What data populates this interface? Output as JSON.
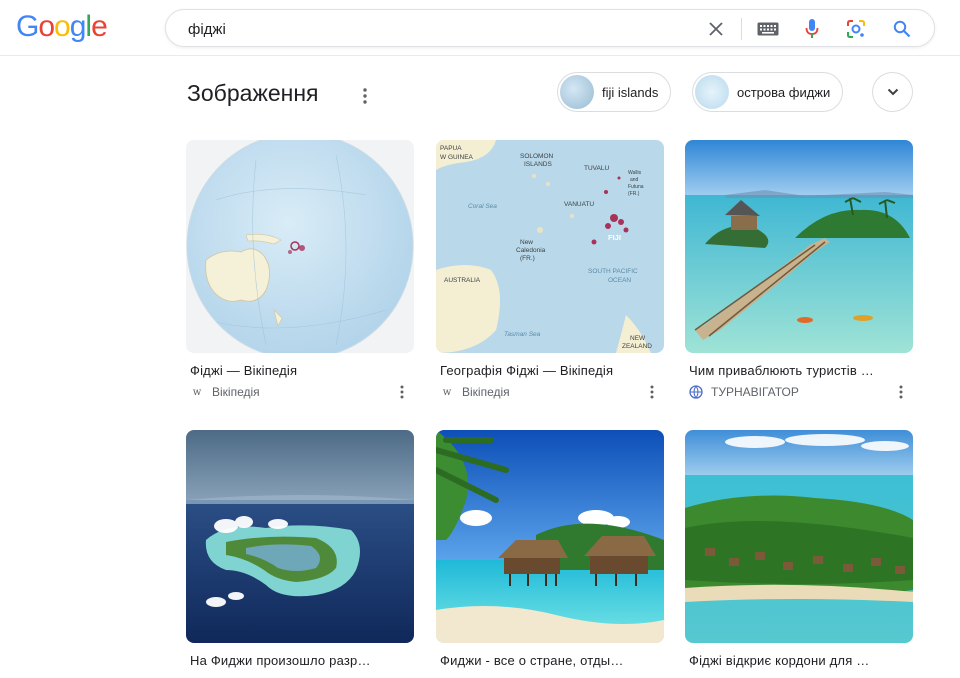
{
  "logo": {
    "letters": [
      "G",
      "o",
      "o",
      "g",
      "l",
      "e"
    ],
    "colors": [
      "#4285F4",
      "#EA4335",
      "#FBBC05",
      "#4285F4",
      "#34A853",
      "#EA4335"
    ]
  },
  "search": {
    "value": "фіджі",
    "clear_icon": "close-icon",
    "keyboard_icon": "keyboard-icon",
    "voice_icon": "mic-icon",
    "lens_icon": "lens-icon",
    "search_icon": "search-icon"
  },
  "images_section": {
    "title": "Зображення",
    "chips": [
      {
        "label": "fiji islands"
      },
      {
        "label": "острова фиджи"
      }
    ]
  },
  "results": [
    {
      "title": "Фіджі — Вікіпедія",
      "source": "Вікіпедія",
      "favicon": "w"
    },
    {
      "title": "Географія Фіджі — Вікіпедія",
      "source": "Вікіпедія",
      "favicon": "w"
    },
    {
      "title": "Чим приваблюють туристів …",
      "source": "ТУРНАВІГАТОР",
      "favicon": ""
    },
    {
      "title": "На Фиджи произошло разр…",
      "source": "",
      "favicon": ""
    },
    {
      "title": "Фиджи - все о стране, отды…",
      "source": "",
      "favicon": ""
    },
    {
      "title": "Фіджі відкриє кордони для …",
      "source": "",
      "favicon": ""
    }
  ],
  "map_labels": {
    "papua": "PAPUA",
    "guinea": "W GUINEA",
    "solomon": "SOLOMON",
    "islands": "ISLANDS",
    "tuvalu": "TUVALU",
    "wallis": "Wallis",
    "and": "and",
    "futuna": "Futuna",
    "fr": "(FR.)",
    "coral": "Coral Sea",
    "vanuatu": "VANUATU",
    "fiji": "FIJI",
    "new": "New",
    "caledonia": "Caledonia",
    "fr2": "(FR.)",
    "australia": "AUSTRALIA",
    "south": "SOUTH PACIFIC",
    "ocean": "OCEAN",
    "tasman": "Tasman Sea",
    "nz1": "NEW",
    "nz2": "ZEALAND"
  }
}
